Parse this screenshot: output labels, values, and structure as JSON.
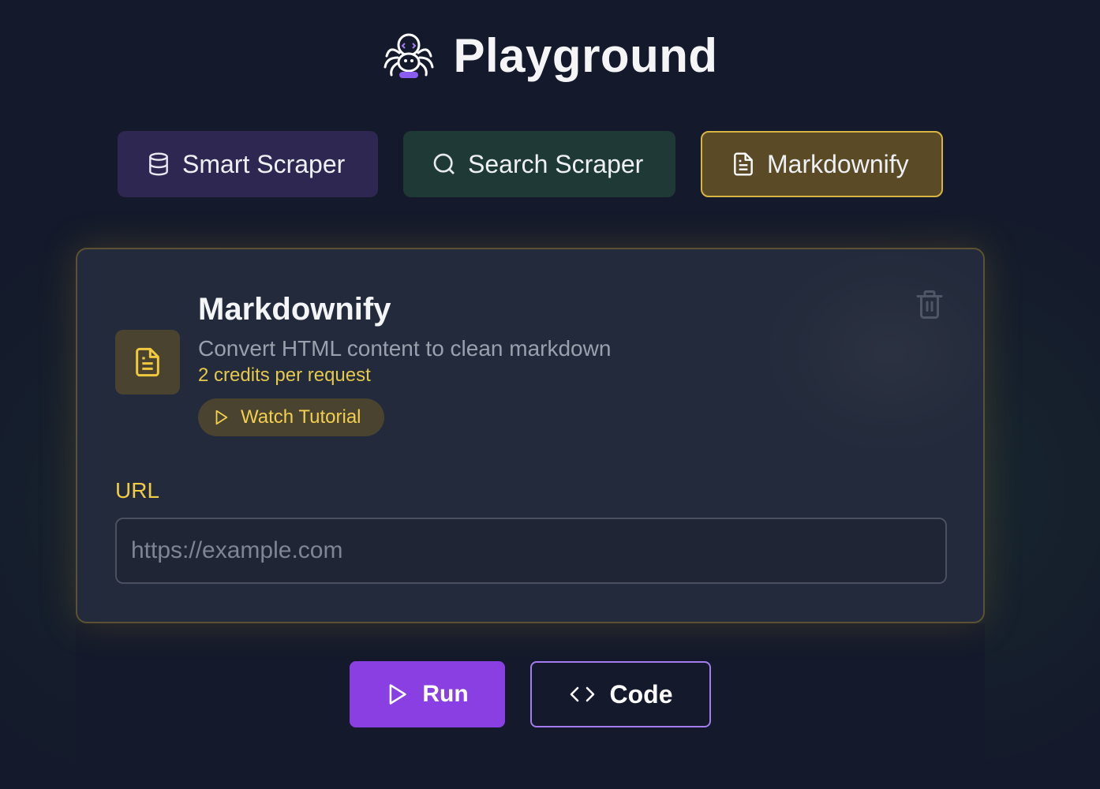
{
  "header": {
    "title": "Playground",
    "logo_icon": "spider-mascot-icon"
  },
  "tabs": [
    {
      "label": "Smart Scraper",
      "icon": "database-icon",
      "color": "#2e2752"
    },
    {
      "label": "Search Scraper",
      "icon": "search-icon",
      "color": "#1f3a36"
    },
    {
      "label": "Markdownify",
      "icon": "document-icon",
      "color": "#5a4a26",
      "active": true
    }
  ],
  "card": {
    "title": "Markdownify",
    "description": "Convert HTML content to clean markdown",
    "credits": "2 credits per request",
    "tutorial_label": "Watch Tutorial",
    "url_label": "URL",
    "url_placeholder": "https://example.com",
    "url_value": ""
  },
  "actions": {
    "run_label": "Run",
    "code_label": "Code"
  },
  "colors": {
    "accent": "#8a3fe3",
    "gold": "#e6c94a",
    "background": "#141a2b"
  }
}
